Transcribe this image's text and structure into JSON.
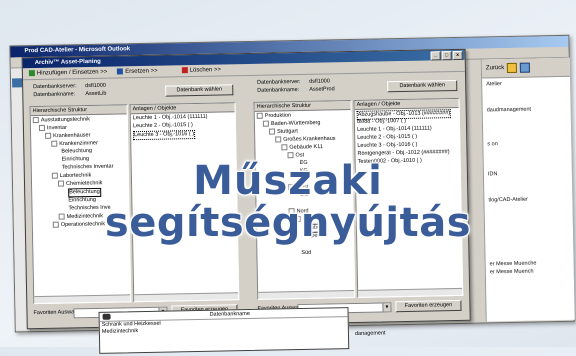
{
  "outer_window": {
    "title": "Prod CAD-Atelier - Microsoft Outlook"
  },
  "right_panel": {
    "back_label": "Zurück",
    "lines": [
      "Atelier",
      "daudmanagement",
      "s on",
      "IDN",
      "tlog/CAD-Atelier",
      "er Messe Muenche",
      "er Messe Muench"
    ]
  },
  "dialog": {
    "title": "Archiv™ Asset-Planing",
    "controls": [
      "_",
      "□",
      "x"
    ],
    "toolbar": {
      "insert": "Hinzufügen / Einsetzen >>",
      "replace": "Ersetzen >>",
      "delete": "Löschen >>"
    },
    "left": {
      "server_label": "Datenbankserver:",
      "server_value": "dsfl1000",
      "db_label": "Datenbankname:",
      "db_value": "AssetLib",
      "select_db": "Datenbank wählen",
      "tree_header": "Hierarchische Struktur",
      "list_header": "Anlagen / Objekte",
      "tree": [
        "Ausstattungstechnik",
        "Inventar",
        "Krankenhäuser",
        "Krankenzimmer",
        "Beleuchtung",
        "Einrichtung",
        "Technisches Inventar",
        "Labortechnik",
        "Chemietechnik",
        "Beleuchtung",
        "Einrichtung",
        "Technisches Inve",
        "Medizintechnik",
        "Operationstechnik"
      ],
      "list": [
        "Leuchte 1 - Obj.-1014 (111111)",
        "Leuchte 2 - Obj.-1015 ( )",
        "Leuchte 3 - Obj.-1016 ( )"
      ],
      "fav_label": "Favoriten Auswahl",
      "fav_create": "Favoriten erzeugen"
    },
    "right": {
      "server_label": "Datenbankserver:",
      "server_value": "dsfl1000",
      "db_label": "Datenbankname:",
      "db_value": "AssetProd",
      "select_db": "Datenbank wählen",
      "tree_header": "Hierarchische Struktur",
      "list_header": "Anlagen / Objekte",
      "tree": [
        "Produktion",
        "Baden-Württemberg",
        "Stuttgart",
        "Großes Krankenhaus",
        "Gebäude K11",
        "Ost",
        "EG",
        "KG",
        "OG",
        "West",
        "EG",
        "Nord",
        "EG",
        "Labor",
        "Operat",
        "Süd"
      ],
      "list": [
        "Abzugshaube - Obj.-1013 (########)",
        "dsf88 - Obj.-1007 ( )",
        "Leuchte 1 - Obj.-1014 (111111)",
        "Leuchte 2 - Obj.-1015 ( )",
        "Leuchte 3 - Obj.-1016 ( )",
        "Röntgengerät - Obj.-1012 (########)",
        "Testen0002 - Obj.-1010 ( )"
      ],
      "fav_label": "Favoriten Auswahl",
      "fav_create": "Favoriten erzeugen"
    }
  },
  "dropdown": {
    "header": "Datenbankname",
    "rows": [
      "Schrank und Heizkessel",
      "Medizintechnik"
    ]
  },
  "bottom_text": "danagement",
  "headline": {
    "line1": "Műszaki",
    "line2": "segítségnyújtás"
  }
}
